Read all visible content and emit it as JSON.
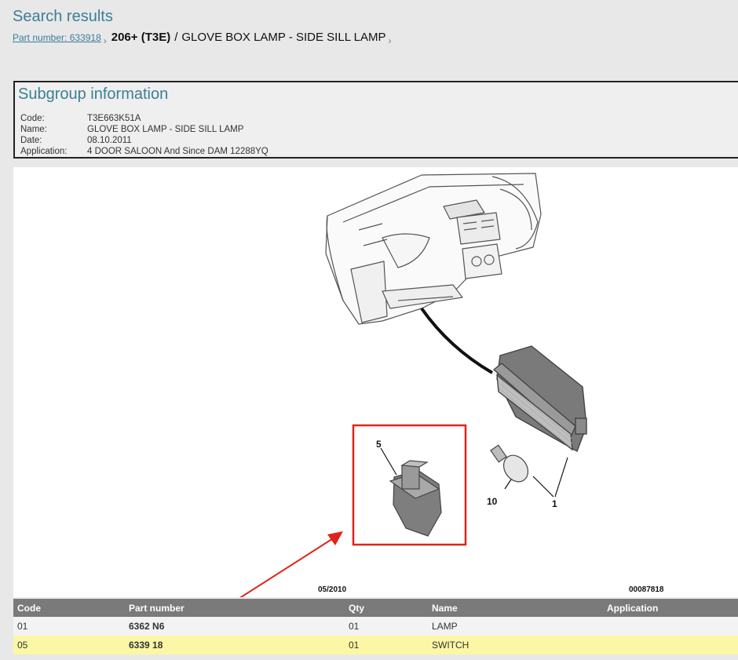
{
  "header": {
    "title": "Search results",
    "breadcrumb_link": "Part number: 633918",
    "breadcrumb_sep": "›",
    "model": "206+ (T3E)",
    "slash": "/",
    "current": "GLOVE BOX LAMP - SIDE SILL LAMP",
    "end_sep": "›"
  },
  "subgroup": {
    "title": "Subgroup information",
    "rows": [
      {
        "label": "Code:",
        "value": "T3E663K51A"
      },
      {
        "label": "Name:",
        "value": "GLOVE BOX LAMP - SIDE SILL LAMP"
      },
      {
        "label": "Date:",
        "value": "08.10.2011"
      },
      {
        "label": "Application:",
        "value": "4 DOOR SALOON And Since DAM 12288YQ"
      }
    ]
  },
  "diagram": {
    "callouts": [
      "5",
      "10",
      "1"
    ],
    "date_label": "05/2010",
    "ref_number": "00087818",
    "highlight_color": "#e0231a",
    "arrow_color": "#e0231a"
  },
  "table": {
    "headers": [
      "Code",
      "Part number",
      "Qty",
      "Name",
      "Application"
    ],
    "rows": [
      {
        "code": "01",
        "part_number": "6362 N6",
        "qty": "01",
        "name": "LAMP",
        "application": ""
      },
      {
        "code": "05",
        "part_number": "6339 18",
        "qty": "01",
        "name": "SWITCH",
        "application": ""
      }
    ],
    "selected_row_color": "#fbf7a4",
    "header_color": "#7a7a7a"
  }
}
